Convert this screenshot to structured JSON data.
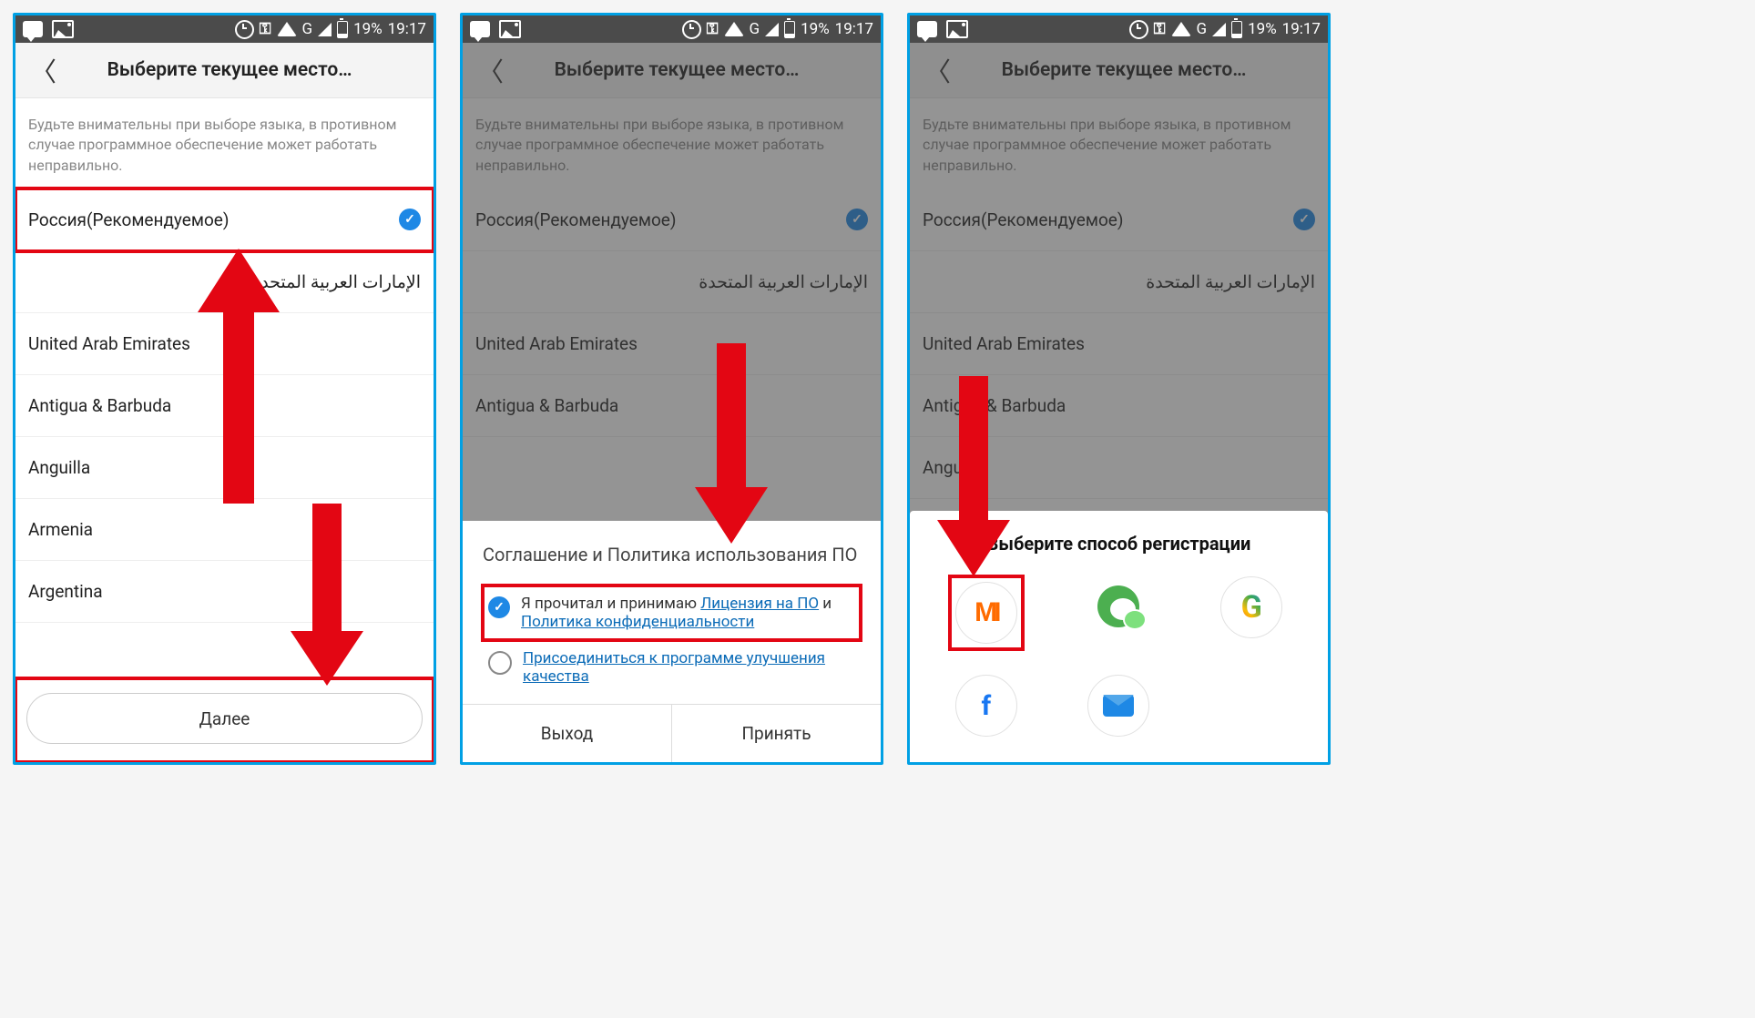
{
  "statusbar": {
    "g": "G",
    "battery_pct": "19%",
    "time": "19:17"
  },
  "header": {
    "title": "Выберите текущее место…"
  },
  "info": "Будьте внимательны при выборе языка, в противном случае программное обеспечение может работать неправильно.",
  "countries": {
    "recommended": "Россия(Рекомендуемое)",
    "uae_ar": "الإمارات العربية المتحدة",
    "uae": "United Arab Emirates",
    "antigua": "Antigua & Barbuda",
    "anguilla": "Anguilla",
    "armenia": "Armenia",
    "argentina": "Argentina"
  },
  "footer_button": "Далее",
  "dialog": {
    "title": "Соглашение и Политика использования ПО",
    "accept_prefix": "Я прочитал и принимаю ",
    "license_link": "Лицензия на ПО",
    "and": " и ",
    "privacy_link": "Политика конфиденциальности",
    "quality_link": "Присоединиться к программе улучшения качества",
    "exit": "Выход",
    "accept": "Принять"
  },
  "sheet": {
    "title": "Выберите способ регистрации",
    "mi": "MI"
  }
}
